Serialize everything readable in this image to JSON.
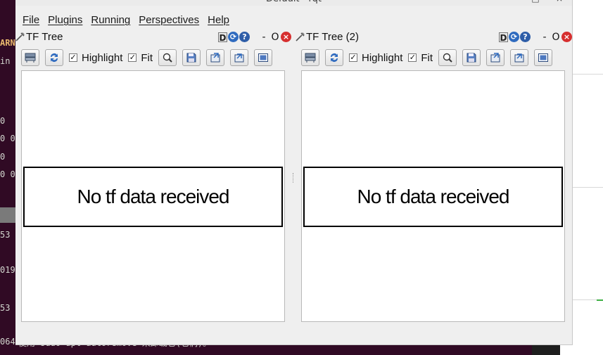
{
  "background": {
    "terminal_left_snippets": [
      "ARN",
      "in",
      "0",
      "0 0",
      "0",
      "0 0",
      "53",
      "019",
      "53",
      "064"
    ],
    "terminal_bottom_text": "使用 sudo apt autoremove 来卸载它(它们)。"
  },
  "window": {
    "title": "Default - rqt",
    "controls": {
      "minimize": "–",
      "maximize": "□",
      "close": "×"
    }
  },
  "menubar": {
    "items": [
      {
        "label": "File"
      },
      {
        "label": "Plugins"
      },
      {
        "label": "Running"
      },
      {
        "label": "Perspectives"
      },
      {
        "label": "Help"
      }
    ]
  },
  "panels": [
    {
      "title": "TF Tree",
      "header_buttons": {
        "d": "D",
        "reload": "⟳",
        "help": "?",
        "minimize": "-",
        "float": "O",
        "close": "×"
      },
      "toolbar": {
        "highlight_label": "Highlight",
        "highlight_checked": "✓",
        "fit_label": "Fit",
        "fit_checked": "✓"
      },
      "message": "No tf data received"
    },
    {
      "title": "TF Tree (2)",
      "header_buttons": {
        "d": "D",
        "reload": "⟳",
        "help": "?",
        "minimize": "-",
        "float": "O",
        "close": "×"
      },
      "toolbar": {
        "highlight_label": "Highlight",
        "highlight_checked": "✓",
        "fit_label": "Fit",
        "fit_checked": "✓"
      },
      "message": "No tf data received"
    }
  ],
  "icons": {
    "tools": "tools-icon",
    "reload": "refresh-icon",
    "help": "help-icon",
    "close": "close-icon",
    "zoom_fit": "zoom-icon",
    "save": "save-icon",
    "export_dot": "export-icon",
    "export_image": "image-icon"
  },
  "colors": {
    "close_red": "#d62f2f",
    "reload_blue": "#2f6bbf",
    "terminal_bg": "#300a24"
  }
}
